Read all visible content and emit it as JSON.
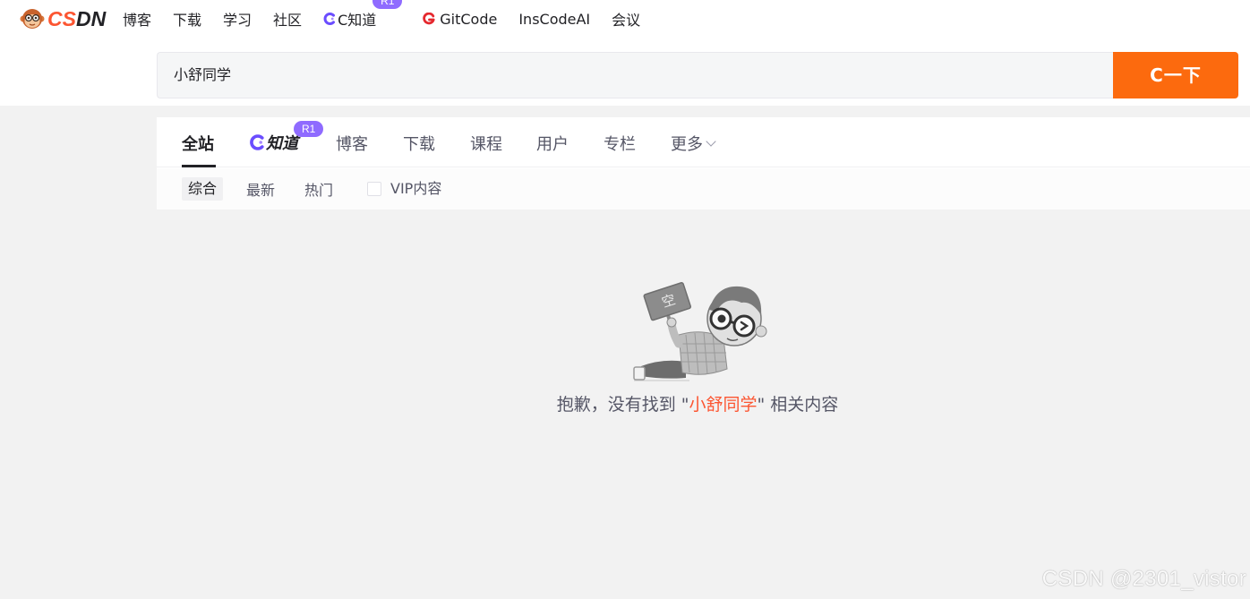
{
  "brand": {
    "logo_text_cs": "CS",
    "logo_text_dn": "DN",
    "accent": "#fc5531",
    "button_color": "#fc6a0e",
    "badge_color": "#8f6bff"
  },
  "topnav": {
    "items": [
      {
        "label": "博客"
      },
      {
        "label": "下载"
      },
      {
        "label": "学习"
      },
      {
        "label": "社区"
      },
      {
        "label": "C知道",
        "icon": "c-zhidao-icon",
        "badge": "R1"
      },
      {
        "label": "GitCode",
        "icon": "gitcode-icon"
      },
      {
        "label": "InsCodeAI"
      },
      {
        "label": "会议"
      }
    ]
  },
  "search": {
    "value": "小舒同学",
    "button_label": "C一下"
  },
  "tabs": {
    "items": [
      {
        "label": "全站",
        "active": true
      },
      {
        "label": "知道",
        "badge": "R1",
        "icon": "c-zhidao-icon"
      },
      {
        "label": "博客"
      },
      {
        "label": "下载"
      },
      {
        "label": "课程"
      },
      {
        "label": "用户"
      },
      {
        "label": "专栏"
      },
      {
        "label": "更多",
        "icon": "chevron-down-icon"
      }
    ]
  },
  "subtabs": {
    "items": [
      {
        "label": "综合",
        "active": true
      },
      {
        "label": "最新"
      },
      {
        "label": "热门"
      }
    ],
    "vip_label": "VIP内容",
    "vip_checked": false
  },
  "empty": {
    "sign_text": "空",
    "prefix": "抱歉，没有找到 \"",
    "keyword": "小舒同学",
    "suffix": "\" 相关内容"
  },
  "watermark": "CSDN @2301_vistor"
}
